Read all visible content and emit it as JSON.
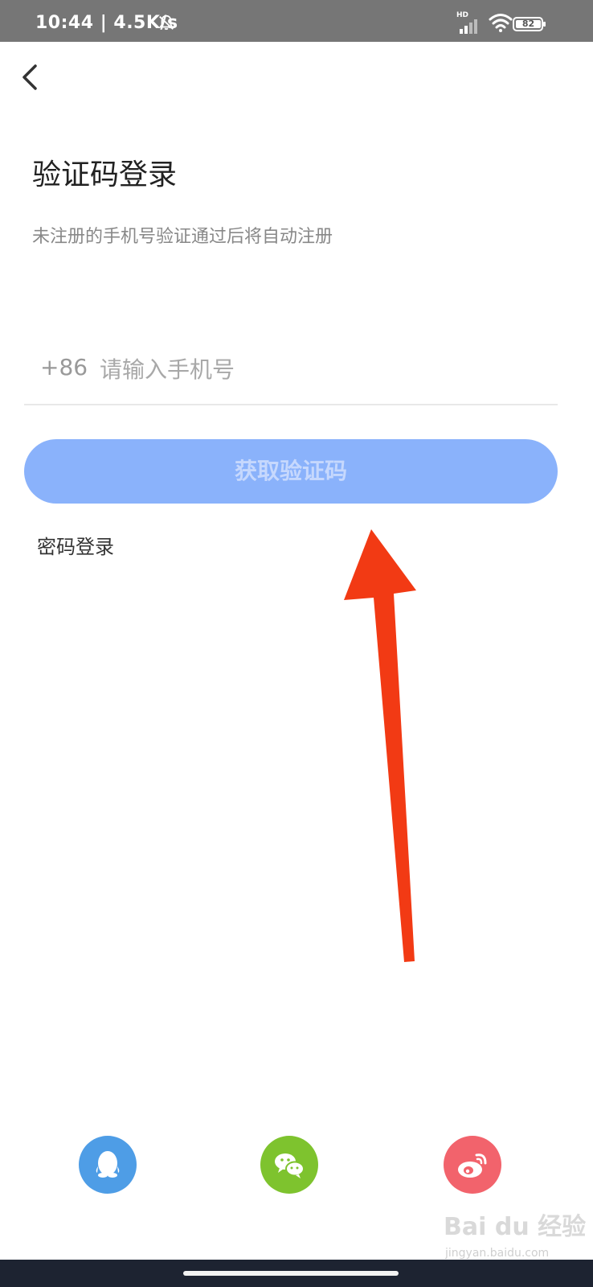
{
  "status_bar": {
    "time_speed": "10:44 | 4.5K/s",
    "network_label": "HD",
    "battery": "82"
  },
  "page": {
    "title": "验证码登录",
    "subtitle": "未注册的手机号验证通过后将自动注册"
  },
  "phone": {
    "country_code": "+86",
    "placeholder": "请输入手机号"
  },
  "buttons": {
    "get_code": "获取验证码",
    "password_login": "密码登录"
  },
  "watermark": {
    "brand": "Bai du 经验",
    "domain": "jingyan.baidu.com"
  },
  "colors": {
    "primary_disabled": "#8ab2fb",
    "annotation_arrow": "#f23a14",
    "qq": "#4e9de6",
    "wechat": "#7ec32e",
    "weibo": "#f2636c"
  },
  "social_icons": [
    "qq-icon",
    "wechat-icon",
    "weibo-icon"
  ]
}
